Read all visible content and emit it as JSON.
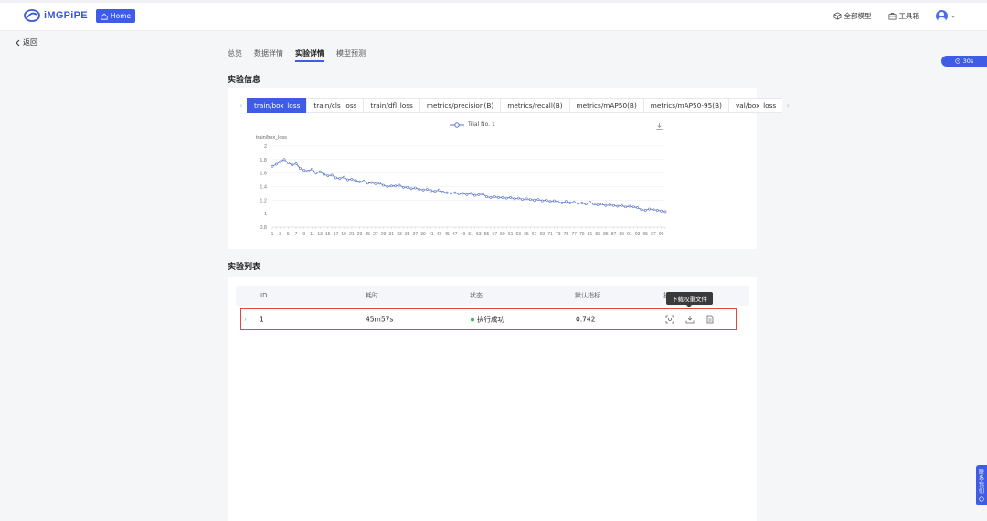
{
  "brand": {
    "name": "iMGPiPE",
    "home_label": "Home",
    "accent": "#3e5ce6"
  },
  "header": {
    "all_models": "全部模型",
    "toolbox": "工具箱"
  },
  "back_label": "返回",
  "timer": "30s",
  "contact": [
    "联",
    "系",
    "我",
    "们"
  ],
  "page_tabs": [
    "总览",
    "数据详情",
    "实验详情",
    "模型预测"
  ],
  "active_page_tab": 2,
  "experiment_info_title": "实验信息",
  "experiment_list_title": "实验列表",
  "metric_tabs": [
    "train/box_loss",
    "train/cls_loss",
    "train/dfl_loss",
    "metrics/precision(B)",
    "metrics/recall(B)",
    "metrics/mAP50(B)",
    "metrics/mAP50-95(B)",
    "val/box_loss"
  ],
  "active_metric_tab": 0,
  "chart_data": {
    "type": "line",
    "ylabel": "train/box_loss",
    "legend": "Trial No. 1",
    "ylim": [
      0.8,
      2
    ],
    "yticks": [
      "2",
      "1.8",
      "1.6",
      "1.4",
      "1.2",
      "1",
      "0.8"
    ],
    "xtick_labels": [
      "1",
      "3",
      "5",
      "7",
      "9",
      "11",
      "13",
      "15",
      "17",
      "19",
      "21",
      "23",
      "25",
      "27",
      "29",
      "31",
      "33",
      "35",
      "37",
      "39",
      "41",
      "43",
      "45",
      "47",
      "49",
      "51",
      "53",
      "55",
      "57",
      "59",
      "61",
      "63",
      "65",
      "67",
      "69",
      "71",
      "73",
      "75",
      "77",
      "79",
      "81",
      "83",
      "85",
      "87",
      "89",
      "91",
      "93",
      "95",
      "97",
      "99"
    ],
    "series": [
      {
        "name": "Trial No. 1",
        "color": "#5b74c9",
        "x": [
          1,
          2,
          3,
          4,
          5,
          6,
          7,
          8,
          9,
          10,
          11,
          12,
          13,
          14,
          15,
          16,
          17,
          18,
          19,
          20,
          21,
          22,
          23,
          24,
          25,
          26,
          27,
          28,
          29,
          30,
          31,
          32,
          33,
          34,
          35,
          36,
          37,
          38,
          39,
          40,
          41,
          42,
          43,
          44,
          45,
          46,
          47,
          48,
          49,
          50,
          51,
          52,
          53,
          54,
          55,
          56,
          57,
          58,
          59,
          60,
          61,
          62,
          63,
          64,
          65,
          66,
          67,
          68,
          69,
          70,
          71,
          72,
          73,
          74,
          75,
          76,
          77,
          78,
          79,
          80,
          81,
          82,
          83,
          84,
          85,
          86,
          87,
          88,
          89,
          90,
          91,
          92,
          93,
          94,
          95,
          96,
          97,
          98,
          99,
          100
        ],
        "values": [
          1.7,
          1.73,
          1.77,
          1.8,
          1.75,
          1.72,
          1.74,
          1.67,
          1.64,
          1.63,
          1.66,
          1.6,
          1.62,
          1.58,
          1.56,
          1.57,
          1.53,
          1.52,
          1.54,
          1.5,
          1.51,
          1.49,
          1.47,
          1.48,
          1.45,
          1.46,
          1.44,
          1.45,
          1.42,
          1.4,
          1.41,
          1.41,
          1.42,
          1.39,
          1.39,
          1.37,
          1.38,
          1.36,
          1.35,
          1.36,
          1.34,
          1.33,
          1.35,
          1.32,
          1.31,
          1.3,
          1.31,
          1.29,
          1.3,
          1.28,
          1.3,
          1.27,
          1.28,
          1.29,
          1.25,
          1.24,
          1.25,
          1.24,
          1.24,
          1.23,
          1.24,
          1.22,
          1.23,
          1.21,
          1.22,
          1.21,
          1.2,
          1.21,
          1.19,
          1.2,
          1.18,
          1.19,
          1.17,
          1.16,
          1.18,
          1.16,
          1.17,
          1.15,
          1.16,
          1.14,
          1.17,
          1.14,
          1.13,
          1.14,
          1.12,
          1.13,
          1.12,
          1.11,
          1.12,
          1.1,
          1.11,
          1.1,
          1.09,
          1.06,
          1.05,
          1.07,
          1.06,
          1.05,
          1.04,
          1.03
        ]
      }
    ]
  },
  "table": {
    "headers": [
      "ID",
      "耗时",
      "状态",
      "默认指标",
      "操作"
    ],
    "rows": [
      {
        "id": "1",
        "duration": "45m57s",
        "status": "执行成功",
        "metric": "0.742"
      }
    ],
    "tooltip": "下载权重文件"
  }
}
